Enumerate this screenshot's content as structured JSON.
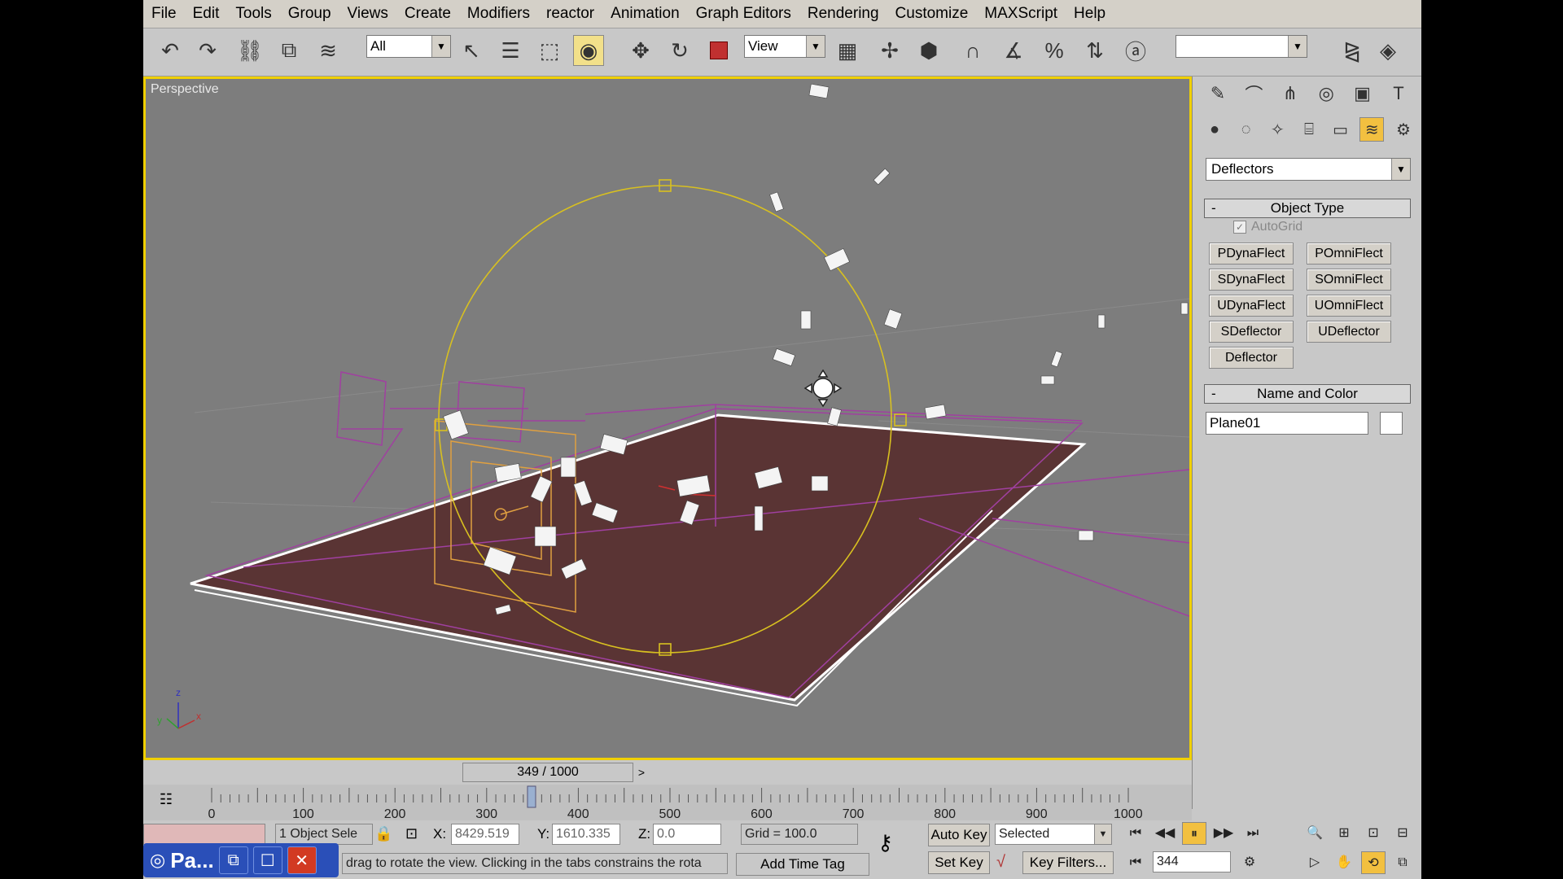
{
  "menu": [
    "File",
    "Edit",
    "Tools",
    "Group",
    "Views",
    "Create",
    "Modifiers",
    "reactor",
    "Animation",
    "Graph Editors",
    "Rendering",
    "Customize",
    "MAXScript",
    "Help"
  ],
  "toolbar": {
    "selection_filter": "All",
    "reference_coord": "View",
    "named_selection": ""
  },
  "viewport": {
    "label": "Perspective",
    "axis_z": "z",
    "axis_x": "x",
    "axis_y": "y"
  },
  "command_panel": {
    "category": "Deflectors",
    "object_type_title": "Object Type",
    "autogrid_label": "AutoGrid",
    "autogrid_checked": true,
    "buttons": [
      "PDynaFlect",
      "POmniFlect",
      "SDynaFlect",
      "SOmniFlect",
      "UDynaFlect",
      "UOmniFlect",
      "SDeflector",
      "UDeflector",
      "Deflector"
    ],
    "name_color_title": "Name and Color",
    "object_name": "Plane01",
    "object_color": "#ffffff"
  },
  "timeline": {
    "frame_display": "349 / 1000",
    "current_frame": 349,
    "total_frames": 1000,
    "ticks": [
      "0",
      "100",
      "200",
      "300",
      "400",
      "500",
      "600",
      "700",
      "800",
      "900",
      "1000"
    ]
  },
  "status": {
    "selection_info": "1 Object Sele",
    "x_label": "X:",
    "x_value": "8429.519",
    "y_label": "Y:",
    "y_value": "1610.335",
    "z_label": "Z:",
    "z_value": "0.0",
    "grid": "Grid = 100.0",
    "prompt": "drag to rotate the view.  Clicking in the tabs constrains the rota",
    "add_time_tag": "Add Time Tag",
    "auto_key": "Auto Key",
    "set_key": "Set Key",
    "key_mode": "Selected",
    "key_filters": "Key Filters...",
    "frame_field": "344"
  },
  "taskbar": {
    "title": "Pa..."
  },
  "colors": {
    "viewport_border": "#f0d000",
    "viewport_bg": "#7d7d7d",
    "plane": "#5a3434",
    "gizmo_sphere": "#d8c020",
    "magenta_lines": "#a040a0",
    "orange_gizmo": "#e0a040"
  }
}
